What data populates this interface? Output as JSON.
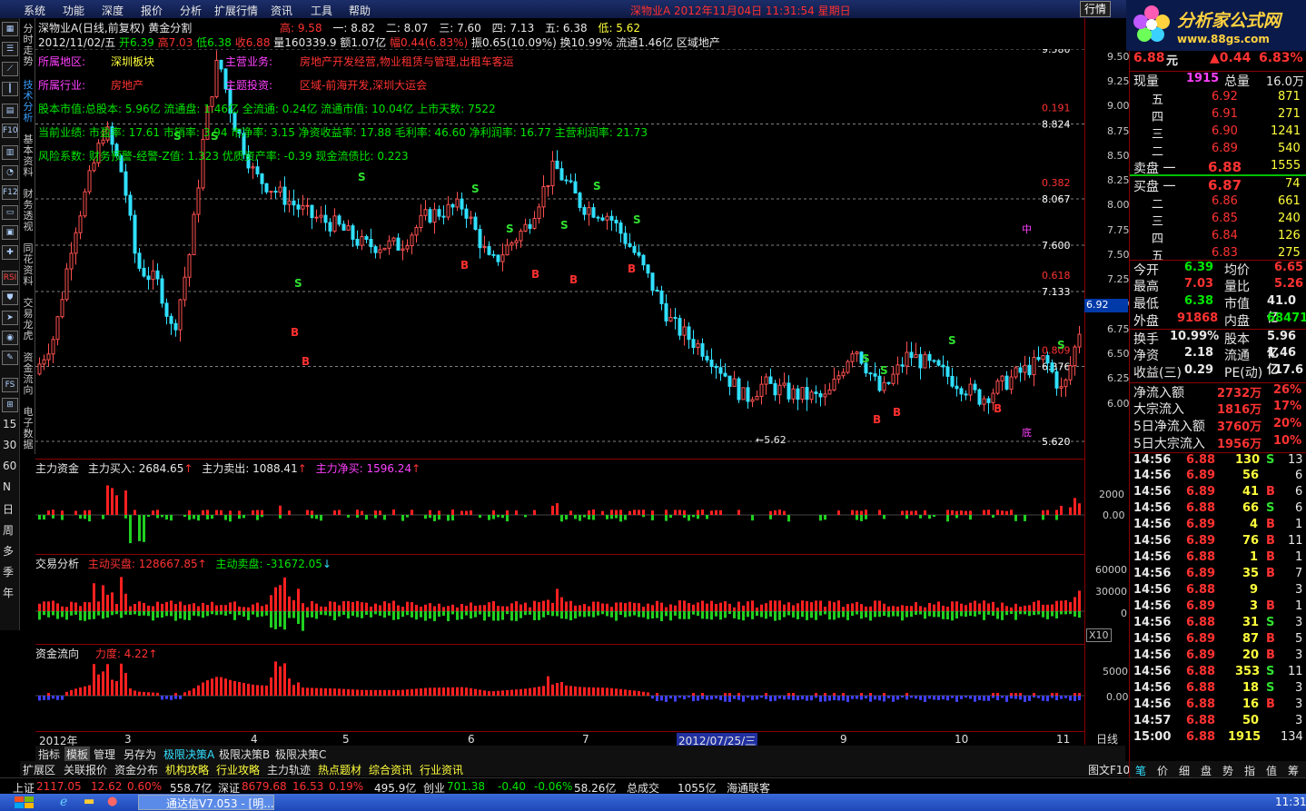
{
  "menu": [
    "系统",
    "功能",
    "深度",
    "报价",
    "分析",
    "扩展行情",
    "资讯",
    "工具",
    "帮助"
  ],
  "menu_title": "深物业A 2012年11月04日 11:31:54 星期日",
  "hq_button": "行情",
  "logo": {
    "text": "分析家公式网",
    "url": "www.88gs.com"
  },
  "left_toolbar_text": [
    "15",
    "30",
    "60",
    "N",
    "日",
    "周",
    "多",
    "季",
    "年"
  ],
  "vertical_tabs": [
    "分时走势",
    "技术分析",
    "基本资料",
    "财务透视",
    "同花资料",
    "交易龙虎",
    "资金流向",
    "电子数据"
  ],
  "chart": {
    "title": "深物业A(日线,前复权) 黄金分割",
    "hi_lo": {
      "high": "高: 9.58",
      "one": "一: 8.82",
      "two": "二: 8.07",
      "three": "三: 7.60",
      "four": "四: 7.13",
      "five": "五: 6.38",
      "low": "低: 5.62"
    },
    "dayline": {
      "date": "2012/11/02/五",
      "open": "开6.39",
      "high": "高7.03",
      "low": "低6.38",
      "close": "收6.88",
      "vol": "量160339.9",
      "amt": "额1.07亿",
      "pct": "幅0.44(6.83%)",
      "amp": "振0.65(10.09%)",
      "turn": "换10.99%",
      "float": "流通1.46亿",
      "sector": "区域地产"
    },
    "info": {
      "region_label": "所属地区:",
      "region": "深圳板块",
      "biz_label": "主营业务:",
      "biz": "房地产开发经营,物业租赁与管理,出租车客运",
      "industry_label": "所属行业:",
      "industry": "房地产",
      "theme_label": "主题投资:",
      "theme": "区域-前海开发,深圳大运会",
      "line1": "股本市值:总股本: 5.96亿 流通盘: 1.46亿 全流通: 0.24亿 流通市值: 10.04亿 上市天数: 7522",
      "line2": "当前业绩: 市盈率: 17.61 市销率: 3.94 市净率: 3.15 净资收益率: 17.88 毛利率: 46.60 净利润率: 16.77 主营利润率: 21.73",
      "line3": "风险系数: 财务预警-经警-Z值: 1.323 优质资产率: -0.39 现金流债比: 0.223"
    },
    "fib_labels": [
      {
        "v": "9.580",
        "c": "#ffffff"
      },
      {
        "v": "0.191",
        "c": "#ff3232"
      },
      {
        "v": "8.824",
        "c": "#ffffff"
      },
      {
        "v": "0.382",
        "c": "#ff3232"
      },
      {
        "v": "8.067",
        "c": "#ffffff"
      },
      {
        "v": "中",
        "c": "#ff40ff"
      },
      {
        "v": "7.600",
        "c": "#ffffff"
      },
      {
        "v": "0.618",
        "c": "#ff3232"
      },
      {
        "v": "7.133",
        "c": "#ffffff"
      },
      {
        "v": "0.809",
        "c": "#ff3232"
      },
      {
        "v": "6.376",
        "c": "#ffffff"
      },
      {
        "v": "底",
        "c": "#ff40ff"
      },
      {
        "v": "5.620",
        "c": "#ffffff"
      }
    ],
    "price_axis": [
      "9.50",
      "9.25",
      "9.00",
      "8.75",
      "8.50",
      "8.25",
      "8.00",
      "7.75",
      "7.50",
      "7.25",
      "7.00",
      "6.75",
      "6.50",
      "6.25",
      "6.00"
    ],
    "current_price_tag": "6.92",
    "low_marker": "5.62"
  },
  "indicators": {
    "zljz": {
      "name": "主力资金",
      "buy": "主力买入: 2684.65",
      "sell": "主力卖出: 1088.41",
      "net": "主力净买: 1596.24",
      "axis": [
        "2000",
        "0.00"
      ]
    },
    "jyfx": {
      "name": "交易分析",
      "buy": "主动买盘: 128667.85",
      "sell": "主动卖盘: -31672.05",
      "axis": [
        "60000",
        "30000",
        "0"
      ],
      "x10": "X10"
    },
    "zjlx": {
      "name": "资金流向",
      "force": "力度: 4.22",
      "axis": [
        "5000",
        "0.00"
      ]
    }
  },
  "date_axis": [
    "2012年",
    "3",
    "4",
    "5",
    "6",
    "7",
    "2012/07/25/三",
    "9",
    "10",
    "11"
  ],
  "day_btn": "日线",
  "bottom_tabs": [
    "指标",
    "模板",
    "管理",
    "另存为",
    "极限决策A",
    "极限决策B",
    "极限决策C"
  ],
  "bottom_tabs2": [
    "扩展区",
    "关联报价",
    "资金分布",
    "机构攻略",
    "行业攻略",
    "主力轨迹",
    "热点题材",
    "综合资讯",
    "行业资讯"
  ],
  "right": {
    "price": "6.88",
    "unit": "元",
    "chg": "▲0.44",
    "pct": "6.83%",
    "xianliang_label": "现量",
    "xianliang": "1915",
    "zongliang_label": "总量",
    "zongliang": "16.0万",
    "asks": [
      {
        "l": "五",
        "p": "6.92",
        "v": "871"
      },
      {
        "l": "四",
        "p": "6.91",
        "v": "271"
      },
      {
        "l": "三",
        "p": "6.90",
        "v": "1241"
      },
      {
        "l": "二",
        "p": "6.89",
        "v": "540"
      },
      {
        "l": "卖盘 一",
        "p": "6.88",
        "v": "1555"
      }
    ],
    "bids": [
      {
        "l": "买盘 一",
        "p": "6.87",
        "v": "74"
      },
      {
        "l": "二",
        "p": "6.86",
        "v": "661"
      },
      {
        "l": "三",
        "p": "6.85",
        "v": "240"
      },
      {
        "l": "四",
        "p": "6.84",
        "v": "126"
      },
      {
        "l": "五",
        "p": "6.83",
        "v": "275"
      }
    ],
    "stats": [
      {
        "a": "今开",
        "av": "6.39",
        "ac": "#00e600",
        "b": "均价",
        "bv": "6.65",
        "bc": "#ff3232"
      },
      {
        "a": "最高",
        "av": "7.03",
        "ac": "#ff3232",
        "b": "量比",
        "bv": "5.26",
        "bc": "#ff3232"
      },
      {
        "a": "最低",
        "av": "6.38",
        "ac": "#00e600",
        "b": "市值",
        "bv": "41.0亿",
        "bc": "#e8e8e8"
      },
      {
        "a": "外盘",
        "av": "91868",
        "ac": "#ff3232",
        "b": "内盘",
        "bv": "68471",
        "bc": "#00e600"
      },
      {
        "a": "换手",
        "av": "10.99%",
        "ac": "#e8e8e8",
        "b": "股本",
        "bv": "5.96亿",
        "bc": "#e8e8e8"
      },
      {
        "a": "净资",
        "av": "2.18",
        "ac": "#e8e8e8",
        "b": "流通",
        "bv": "1.46亿",
        "bc": "#e8e8e8"
      },
      {
        "a": "收益(三)",
        "av": "0.29",
        "ac": "#e8e8e8",
        "b": "PE(动)",
        "bv": "17.6",
        "bc": "#e8e8e8"
      }
    ],
    "flows": [
      {
        "l": "净流入额",
        "v": "2732万",
        "p": "26%"
      },
      {
        "l": "大宗流入",
        "v": "1816万",
        "p": "17%"
      },
      {
        "l": "5日净流入额",
        "v": "3760万",
        "p": "20%"
      },
      {
        "l": "5日大宗流入",
        "v": "1956万",
        "p": "10%"
      }
    ],
    "ticks": [
      {
        "t": "14:56",
        "p": "6.88",
        "v": "130",
        "s": "S",
        "n": "13"
      },
      {
        "t": "14:56",
        "p": "6.89",
        "v": "56",
        "s": "",
        "n": "6"
      },
      {
        "t": "14:56",
        "p": "6.89",
        "v": "41",
        "s": "B",
        "n": "6"
      },
      {
        "t": "14:56",
        "p": "6.88",
        "v": "66",
        "s": "S",
        "n": "6"
      },
      {
        "t": "14:56",
        "p": "6.89",
        "v": "4",
        "s": "B",
        "n": "1"
      },
      {
        "t": "14:56",
        "p": "6.89",
        "v": "76",
        "s": "B",
        "n": "11"
      },
      {
        "t": "14:56",
        "p": "6.88",
        "v": "1",
        "s": "B",
        "n": "1"
      },
      {
        "t": "14:56",
        "p": "6.89",
        "v": "35",
        "s": "B",
        "n": "7"
      },
      {
        "t": "14:56",
        "p": "6.88",
        "v": "9",
        "s": "",
        "n": "3"
      },
      {
        "t": "14:56",
        "p": "6.89",
        "v": "3",
        "s": "B",
        "n": "1"
      },
      {
        "t": "14:56",
        "p": "6.88",
        "v": "31",
        "s": "S",
        "n": "3"
      },
      {
        "t": "14:56",
        "p": "6.89",
        "v": "87",
        "s": "B",
        "n": "5"
      },
      {
        "t": "14:56",
        "p": "6.89",
        "v": "20",
        "s": "B",
        "n": "3"
      },
      {
        "t": "14:56",
        "p": "6.88",
        "v": "353",
        "s": "S",
        "n": "11"
      },
      {
        "t": "14:56",
        "p": "6.88",
        "v": "18",
        "s": "S",
        "n": "3"
      },
      {
        "t": "14:56",
        "p": "6.88",
        "v": "16",
        "s": "B",
        "n": "3"
      },
      {
        "t": "14:57",
        "p": "6.88",
        "v": "50",
        "s": "",
        "n": "3"
      },
      {
        "t": "15:00",
        "p": "6.88",
        "v": "1915",
        "s": "",
        "n": "134"
      }
    ],
    "bottom_btns": [
      "笔",
      "价",
      "细",
      "盘",
      "势",
      "指",
      "值",
      "筹"
    ],
    "f10": "图文F10"
  },
  "status": {
    "sh_label": "上证",
    "sh": "2117.05",
    "sh_chg": "12.62",
    "sh_pct": "0.60%",
    "sh_amt": "558.7亿",
    "sz_label": "深证",
    "sz": "8679.68",
    "sz_chg": "16.53",
    "sz_pct": "0.19%",
    "sz_amt": "495.9亿",
    "cy_label": "创业",
    "cy": "701.38",
    "cy_chg": "-0.40",
    "cy_pct": "-0.06%",
    "cy_amt": "58.26亿",
    "total_label": "总成交",
    "total": "1055亿",
    "broker": "海通联客"
  },
  "taskbar": {
    "app": "通达信V7.053 - [明...",
    "time": "11:31"
  }
}
